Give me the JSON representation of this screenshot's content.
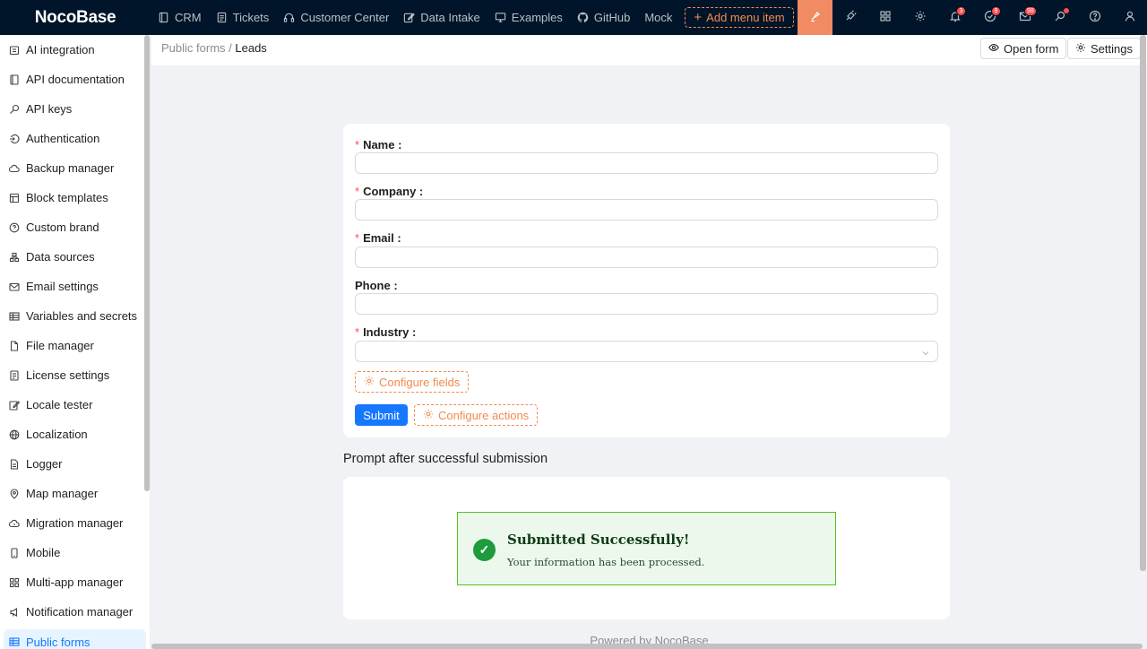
{
  "app": {
    "logo": "NocoBase"
  },
  "topnav": [
    {
      "label": "CRM",
      "icon": "book-icon"
    },
    {
      "label": "Tickets",
      "icon": "document-icon"
    },
    {
      "label": "Customer Center",
      "icon": "headset-icon"
    },
    {
      "label": "Data Intake",
      "icon": "edit-icon"
    },
    {
      "label": "Examples",
      "icon": "desktop-icon"
    },
    {
      "label": "GitHub",
      "icon": "github-icon"
    },
    {
      "label": "Mock",
      "icon": ""
    }
  ],
  "add_menu_label": "Add menu item",
  "tools": {
    "notifications_badge": "3",
    "tasks_badge": "9",
    "inbox_badge": "98"
  },
  "sidebar": {
    "items": [
      {
        "label": "AI integration",
        "icon": "robot-icon"
      },
      {
        "label": "API documentation",
        "icon": "book-icon"
      },
      {
        "label": "API keys",
        "icon": "key-icon"
      },
      {
        "label": "Authentication",
        "icon": "login-icon"
      },
      {
        "label": "Backup manager",
        "icon": "cloud-icon"
      },
      {
        "label": "Block templates",
        "icon": "layout-icon"
      },
      {
        "label": "Custom brand",
        "icon": "question-circle-icon"
      },
      {
        "label": "Data sources",
        "icon": "database-icon"
      },
      {
        "label": "Email settings",
        "icon": "mail-icon"
      },
      {
        "label": "Variables and secrets",
        "icon": "table-icon"
      },
      {
        "label": "File manager",
        "icon": "file-icon"
      },
      {
        "label": "License settings",
        "icon": "license-icon"
      },
      {
        "label": "Locale tester",
        "icon": "edit-icon"
      },
      {
        "label": "Localization",
        "icon": "globe-icon"
      },
      {
        "label": "Logger",
        "icon": "file-text-icon"
      },
      {
        "label": "Map manager",
        "icon": "environment-icon"
      },
      {
        "label": "Migration manager",
        "icon": "cloud-sync-icon"
      },
      {
        "label": "Mobile",
        "icon": "mobile-icon"
      },
      {
        "label": "Multi-app manager",
        "icon": "appstore-icon"
      },
      {
        "label": "Notification manager",
        "icon": "notification-icon"
      },
      {
        "label": "Public forms",
        "icon": "table-icon",
        "active": true
      }
    ]
  },
  "header": {
    "breadcrumb_parent": "Public forms",
    "breadcrumb_sep": " / ",
    "breadcrumb_current": "Leads",
    "open_form_label": "Open form",
    "settings_label": "Settings"
  },
  "form": {
    "fields": [
      {
        "label": "Name",
        "required": "*",
        "value": ""
      },
      {
        "label": "Company",
        "required": "*",
        "value": ""
      },
      {
        "label": "Email",
        "required": "*",
        "value": ""
      },
      {
        "label": "Phone",
        "required": "",
        "value": ""
      },
      {
        "label": "Industry",
        "required": "*",
        "value": ""
      }
    ],
    "colon": ":",
    "configure_fields_label": "Configure fields",
    "submit_label": "Submit",
    "configure_actions_label": "Configure actions"
  },
  "prompt": {
    "section_title": "Prompt after successful submission",
    "success_title": "Submitted Successfully!",
    "success_desc": "Your information has been processed."
  },
  "footer": {
    "text": "Powered by NocoBase"
  },
  "colors": {
    "accent": "#1677ff",
    "topbar": "#001529",
    "orange": "#f18b4e",
    "success": "#52c41a"
  }
}
